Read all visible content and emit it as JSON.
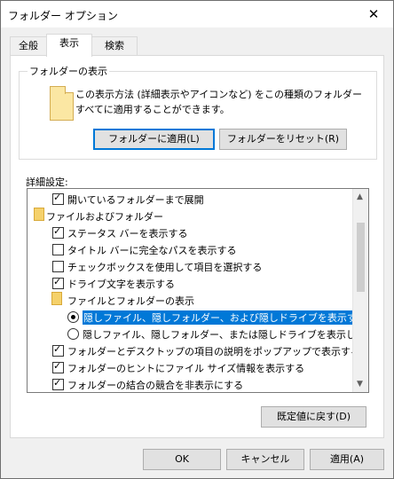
{
  "window": {
    "title": "フォルダー オプション",
    "close": "✕"
  },
  "tabs": [
    {
      "label": "全般"
    },
    {
      "label": "表示"
    },
    {
      "label": "検索"
    }
  ],
  "folder_view": {
    "legend": "フォルダーの表示",
    "description": "この表示方法 (詳細表示やアイコンなど) をこの種類のフォルダーすべてに適用することができます。",
    "apply_button": "フォルダーに適用(L)",
    "reset_button": "フォルダーをリセット(R)"
  },
  "advanced": {
    "label": "詳細設定:",
    "items": [
      {
        "type": "check",
        "checked": true,
        "label": "開いているフォルダーまで展開"
      },
      {
        "type": "folder",
        "label": "ファイルおよびフォルダー"
      },
      {
        "type": "check",
        "checked": true,
        "label": "ステータス バーを表示する"
      },
      {
        "type": "check",
        "checked": false,
        "label": "タイトル バーに完全なパスを表示する"
      },
      {
        "type": "check",
        "checked": false,
        "label": "チェックボックスを使用して項目を選択する"
      },
      {
        "type": "check",
        "checked": true,
        "label": "ドライブ文字を表示する"
      },
      {
        "type": "folder",
        "label": "ファイルとフォルダーの表示"
      },
      {
        "type": "radio",
        "checked": true,
        "label": "隠しファイル、隠しフォルダー、および隠しドライブを表示する"
      },
      {
        "type": "radio",
        "checked": false,
        "label": "隠しファイル、隠しフォルダー、または隠しドライブを表示しない"
      },
      {
        "type": "check",
        "checked": true,
        "label": "フォルダーとデスクトップの項目の説明をポップアップで表示する"
      },
      {
        "type": "check",
        "checked": true,
        "label": "フォルダーのヒントにファイル サイズ情報を表示する"
      },
      {
        "type": "check",
        "checked": true,
        "label": "フォルダーの結合の競合を非表示にする"
      }
    ],
    "default_button": "既定値に戻す(D)"
  },
  "footer": {
    "ok": "OK",
    "cancel": "キャンセル",
    "apply": "適用(A)"
  },
  "colors": {
    "accent": "#0078d7"
  }
}
